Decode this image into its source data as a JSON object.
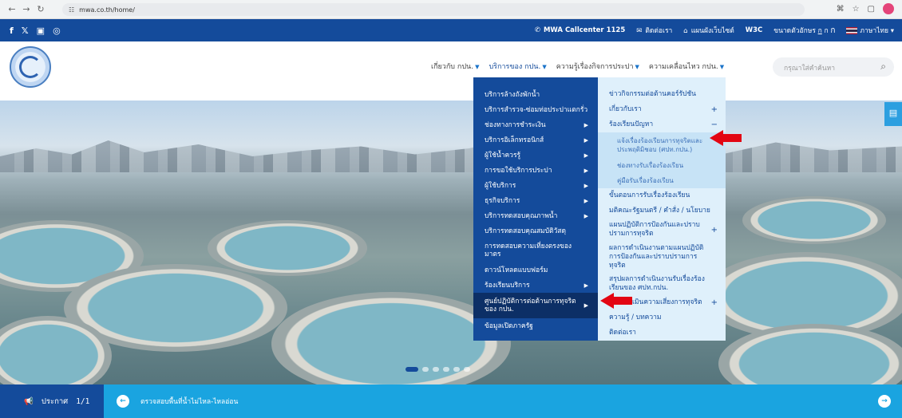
{
  "browser": {
    "url": "mwa.co.th/home/"
  },
  "topbar": {
    "social": [
      "f",
      "𝕏",
      "▣",
      "◎"
    ],
    "callcenter": "MWA Callcenter 1125",
    "contact": "ติดต่อเรา",
    "sitemap": "แผนผังเว็บไซต์",
    "w3c": "W3C",
    "font_size_label": "ขนาดตัวอักษร",
    "font_sizes": [
      "ก",
      "ก",
      "ก"
    ],
    "language": "ภาษาไทย"
  },
  "nav": {
    "items": [
      {
        "label": "เกี่ยวกับ กปน."
      },
      {
        "label": "บริการของ กปน."
      },
      {
        "label": "ความรู้เรื่องกิจการประปา"
      },
      {
        "label": "ความเคลื่อนไหว กปน."
      }
    ],
    "search_placeholder": "กรุณาใส่คำค้นหา"
  },
  "dropdown_left": [
    {
      "label": "บริการล้างถังพักน้ำ",
      "arrow": false
    },
    {
      "label": "บริการสำรวจ-ซ่อมท่อประปาแตกรั่ว",
      "arrow": false
    },
    {
      "label": "ช่องทางการชำระเงิน",
      "arrow": true
    },
    {
      "label": "บริการอิเล็กทรอนิกส์",
      "arrow": true
    },
    {
      "label": "ผู้ใช้น้ำควรรู้",
      "arrow": true
    },
    {
      "label": "การขอใช้บริการประปา",
      "arrow": true
    },
    {
      "label": "ผู้ใช้บริการ",
      "arrow": true
    },
    {
      "label": "ธุรกิจบริการ",
      "arrow": true
    },
    {
      "label": "บริการทดสอบคุณภาพน้ำ",
      "arrow": true
    },
    {
      "label": "บริการทดสอบคุณสมบัติวัสดุ",
      "arrow": false
    },
    {
      "label": "การทดสอบความเที่ยงตรงของมาตร",
      "arrow": false
    },
    {
      "label": "ดาวน์โหลดแบบฟอร์ม",
      "arrow": false
    },
    {
      "label": "ร้องเรียนบริการ",
      "arrow": true
    },
    {
      "label": "ศูนย์ปฏิบัติการต่อต้านการทุจริตของ กปน.",
      "arrow": true
    },
    {
      "label": "ข้อมูลเปิดภาครัฐ",
      "arrow": false
    }
  ],
  "dropdown_right": {
    "items_top": [
      {
        "label": "ข่าวกิจกรรมต่อต้านคอร์รัปชัน",
        "toggle": ""
      },
      {
        "label": "เกี่ยวกับเรา",
        "toggle": "+"
      },
      {
        "label": "ร้องเรียนปัญหา",
        "toggle": "−"
      }
    ],
    "sub_items": [
      {
        "label": "แจ้งเรื่องร้องเรียนการทุจริตและประพฤติมิชอบ (ศปท.กปน.)"
      },
      {
        "label": "ช่องทางรับเรื่องร้องเรียน"
      },
      {
        "label": "คู่มือรับเรื่องร้องเรียน"
      }
    ],
    "items_bottom": [
      {
        "label": "ขั้นตอนการรับเรื่องร้องเรียน",
        "toggle": ""
      },
      {
        "label": "มติคณะรัฐมนตรี / คำสั่ง / นโยบาย",
        "toggle": ""
      },
      {
        "label": "แผนปฏิบัติการป้องกันและปราบปรามการทุจริต",
        "toggle": "+"
      },
      {
        "label": "ผลการดำเนินงานตามแผนปฏิบัติการป้องกันและปราบปรามการทุจริต",
        "toggle": ""
      },
      {
        "label": "สรุปผลการดำเนินงานรับเรื่องร้องเรียนของ ศปท.กปน.",
        "toggle": ""
      },
      {
        "label": "การประเมินความเสี่ยงการทุจริต",
        "toggle": "+"
      },
      {
        "label": "ความรู้ / บทความ",
        "toggle": ""
      },
      {
        "label": "ติดต่อเรา",
        "toggle": ""
      }
    ]
  },
  "newsbar": {
    "label": "ประกาศ",
    "counter": "1/1",
    "text": "ตรวจสอบพื้นที่น้ำไม่ไหล-ไหลอ่อน"
  },
  "colors": {
    "primary": "#144b9b",
    "accent": "#1aa4e0",
    "submenu_bg": "#dff0fb",
    "arrow_red": "#e30613"
  }
}
